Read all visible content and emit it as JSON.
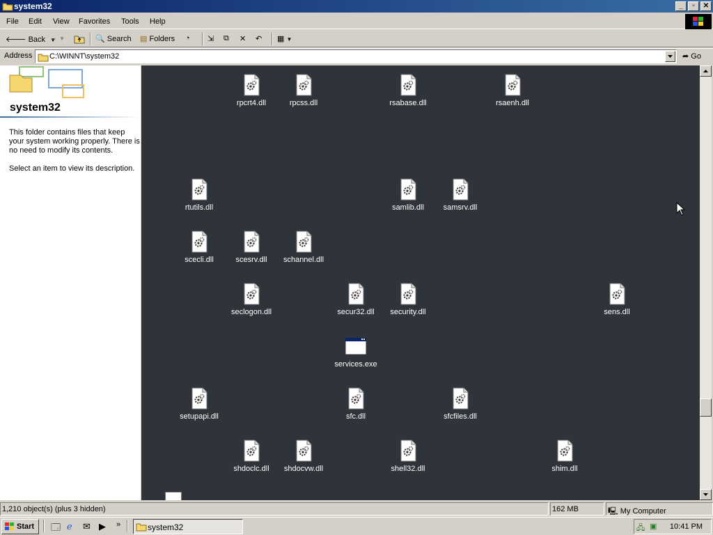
{
  "window": {
    "title": "system32"
  },
  "menu": [
    "File",
    "Edit",
    "View",
    "Favorites",
    "Tools",
    "Help"
  ],
  "toolbar": {
    "back": "Back",
    "search": "Search",
    "folders": "Folders"
  },
  "address": {
    "label": "Address",
    "value": "C:\\WINNT\\system32",
    "go": "Go"
  },
  "left_pane": {
    "title": "system32",
    "description": "This folder contains files that keep your system working properly. There is no need to modify its contents.",
    "hint": "Select an item to view its description."
  },
  "files": [
    {
      "name": "rpcrt4.dll",
      "type": "dll"
    },
    {
      "name": "rpcss.dll",
      "type": "dll"
    },
    {
      "name": "rsabase.dll",
      "type": "dll"
    },
    {
      "name": "rsaenh.dll",
      "type": "dll"
    },
    {
      "name": "rtutils.dll",
      "type": "dll"
    },
    {
      "name": "samlib.dll",
      "type": "dll"
    },
    {
      "name": "samsrv.dll",
      "type": "dll"
    },
    {
      "name": "scecli.dll",
      "type": "dll"
    },
    {
      "name": "scesrv.dll",
      "type": "dll"
    },
    {
      "name": "schannel.dll",
      "type": "dll"
    },
    {
      "name": "seclogon.dll",
      "type": "dll"
    },
    {
      "name": "secur32.dll",
      "type": "dll"
    },
    {
      "name": "security.dll",
      "type": "dll"
    },
    {
      "name": "sens.dll",
      "type": "dll"
    },
    {
      "name": "services.exe",
      "type": "exe"
    },
    {
      "name": "setupapi.dll",
      "type": "dll"
    },
    {
      "name": "sfc.dll",
      "type": "dll"
    },
    {
      "name": "sfcfiles.dll",
      "type": "dll"
    },
    {
      "name": "shdoclc.dll",
      "type": "dll"
    },
    {
      "name": "shdocvw.dll",
      "type": "dll"
    },
    {
      "name": "shell32.dll",
      "type": "dll"
    },
    {
      "name": "shim.dll",
      "type": "dll"
    }
  ],
  "status": {
    "objects": "1,210 object(s) (plus 3 hidden)",
    "size": "162 MB",
    "zone": "My Computer"
  },
  "taskbar": {
    "start": "Start",
    "task": "system32",
    "clock": "10:41 PM"
  },
  "colors": {
    "titlebar_start": "#0a246a",
    "titlebar_end": "#3a6ea5",
    "content_bg": "#2f343a",
    "chrome": "#d4d0c8"
  }
}
